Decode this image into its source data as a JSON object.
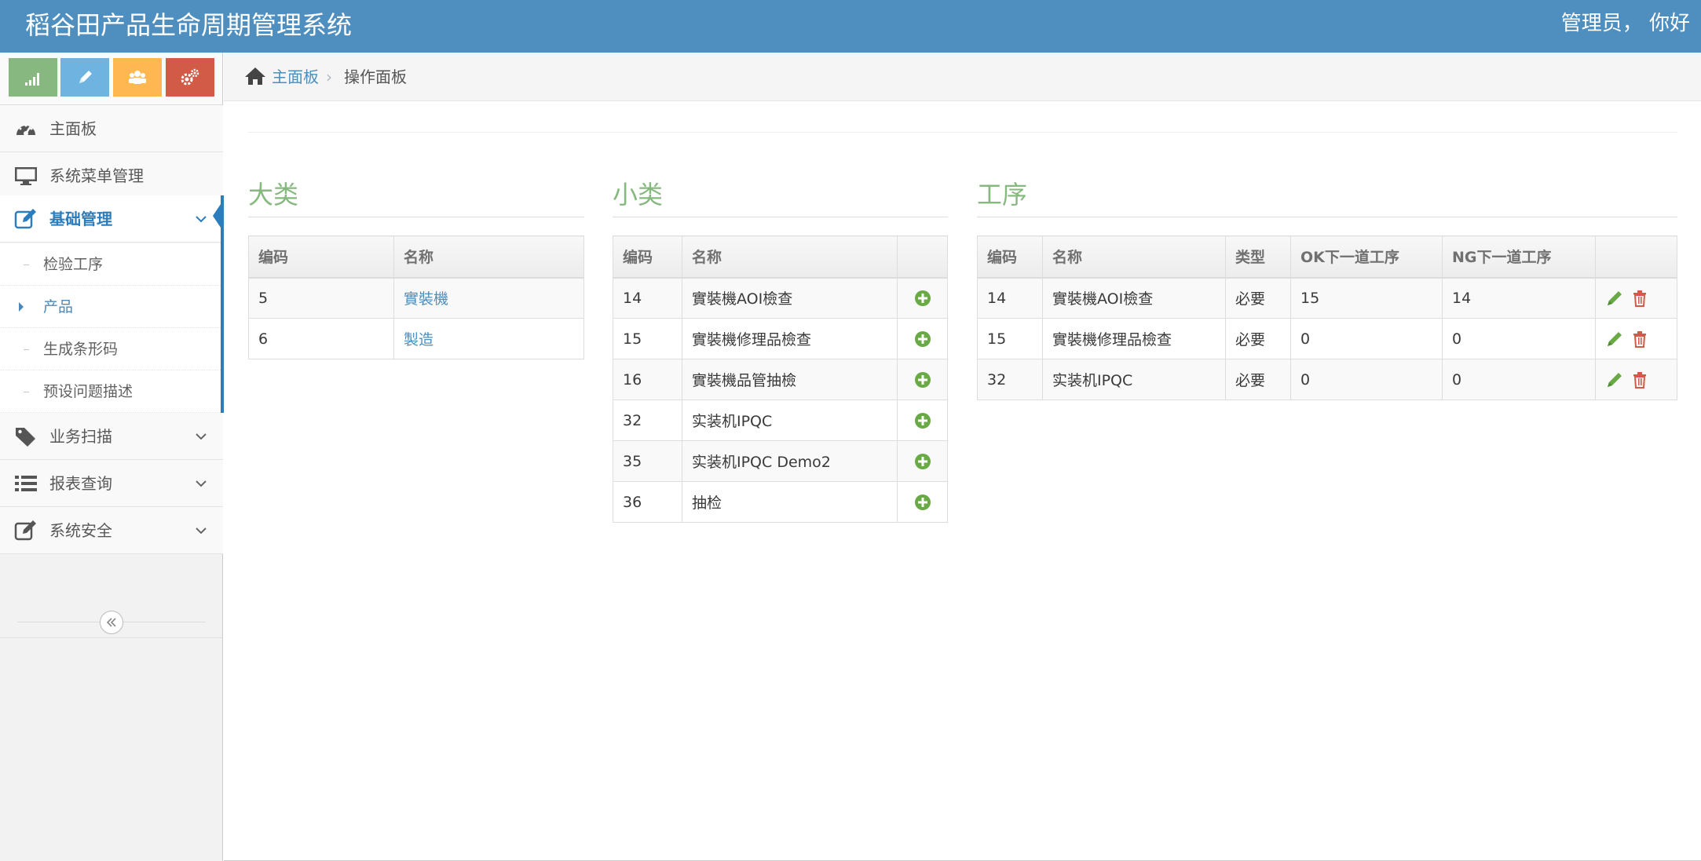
{
  "navbar": {
    "brand": "稻谷田产品生命周期管理系统",
    "user_greeting": "管理员， 你好"
  },
  "colors": {
    "navbar": "#4f8fbf",
    "accent_green": "#87b87f",
    "link_blue": "#4c8fbd",
    "active_blue": "#2b7dbc",
    "shortcut_green": "#87b87f",
    "shortcut_blue": "#6fb3e0",
    "shortcut_orange": "#ffb752",
    "shortcut_red": "#d15b47",
    "delete_red": "#d15b47"
  },
  "shortcuts": [
    {
      "icon": "signal-icon"
    },
    {
      "icon": "pencil-icon"
    },
    {
      "icon": "users-icon"
    },
    {
      "icon": "cogs-icon"
    }
  ],
  "sidebar": {
    "items": [
      {
        "label": "主面板",
        "icon": "dashboard-icon"
      },
      {
        "label": "系统菜单管理",
        "icon": "desktop-icon"
      },
      {
        "label": "基础管理",
        "icon": "edit-icon",
        "active": true
      },
      {
        "label": "业务扫描",
        "icon": "tag-icon"
      },
      {
        "label": "报表查询",
        "icon": "list-icon"
      },
      {
        "label": "系统安全",
        "icon": "edit-icon"
      }
    ],
    "submenu": [
      {
        "label": "检验工序"
      },
      {
        "label": "产品",
        "current": true
      },
      {
        "label": "生成条形码"
      },
      {
        "label": "预设问题描述"
      }
    ]
  },
  "breadcrumb": {
    "home": "主面板",
    "current": "操作面板"
  },
  "major": {
    "title": "大类",
    "headers": [
      "编码",
      "名称"
    ],
    "rows": [
      {
        "code": "5",
        "name": "實裝機"
      },
      {
        "code": "6",
        "name": "製造"
      }
    ]
  },
  "minor": {
    "title": "小类",
    "headers": [
      "编码",
      "名称",
      ""
    ],
    "rows": [
      {
        "code": "14",
        "name": "實裝機AOI檢查"
      },
      {
        "code": "15",
        "name": "實裝機修理品檢查"
      },
      {
        "code": "16",
        "name": "實裝機品管抽檢"
      },
      {
        "code": "32",
        "name": "实装机IPQC"
      },
      {
        "code": "35",
        "name": "实装机IPQC Demo2"
      },
      {
        "code": "36",
        "name": "抽检"
      }
    ]
  },
  "process": {
    "title": "工序",
    "headers": [
      "编码",
      "名称",
      "类型",
      "OK下一道工序",
      "NG下一道工序",
      ""
    ],
    "rows": [
      {
        "code": "14",
        "name": "實裝機AOI檢查",
        "type": "必要",
        "ok_next": "15",
        "ng_next": "14"
      },
      {
        "code": "15",
        "name": "實裝機修理品檢查",
        "type": "必要",
        "ok_next": "0",
        "ng_next": "0"
      },
      {
        "code": "32",
        "name": "实装机IPQC",
        "type": "必要",
        "ok_next": "0",
        "ng_next": "0"
      }
    ]
  }
}
